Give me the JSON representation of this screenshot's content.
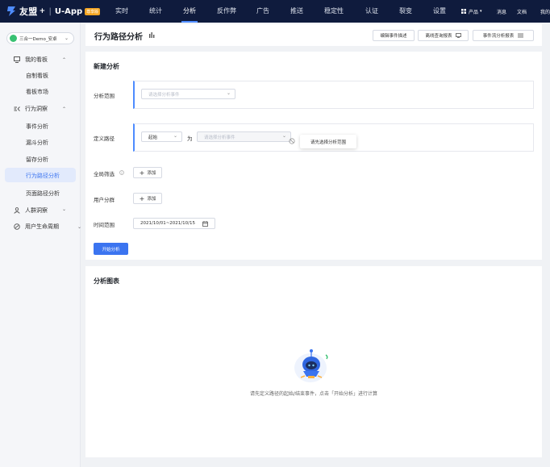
{
  "brand": {
    "name": "友盟",
    "plus": "+",
    "sep": "|",
    "app": "U-App",
    "badge": "尊享版"
  },
  "nav": {
    "items": [
      "实时",
      "统计",
      "分析",
      "反作弊",
      "广告",
      "推送",
      "稳定性",
      "认证",
      "裂变",
      "设置"
    ],
    "active": "分析"
  },
  "top_right": {
    "products": "产品",
    "messages": "消息",
    "docs": "文档",
    "mine": "我的"
  },
  "sidebar": {
    "app_selector": "三合一Demo_安卓",
    "groups": [
      {
        "label": "我的看板",
        "items": [
          "自制看板",
          "看板市场"
        ]
      },
      {
        "label": "行为洞察",
        "items": [
          "事件分析",
          "漏斗分析",
          "留存分析",
          "行为路径分析",
          "页面路径分析"
        ]
      },
      {
        "label": "人群洞察",
        "items": []
      },
      {
        "label": "用户生命周期",
        "items": []
      }
    ],
    "active_item": "行为路径分析"
  },
  "header": {
    "title": "行为路径分析",
    "buttons": [
      "编辑事件描述",
      "离线查询报表",
      "事件流分析报表"
    ]
  },
  "new_analysis": {
    "title": "新建分析",
    "scope": {
      "label": "分析范围",
      "placeholder": "请选择分析事件"
    },
    "path": {
      "label": "定义路径",
      "start_value": "起始",
      "connector": "为",
      "event_placeholder": "请选择分析事件",
      "tooltip": "请先选择分析范围"
    },
    "global_filter": {
      "label": "全局筛选",
      "add": "添加"
    },
    "user_segment": {
      "label": "用户分群",
      "add": "添加"
    },
    "time_range": {
      "label": "时间范围",
      "value": "2021/10/01~2021/10/15"
    },
    "start_button": "开始分析"
  },
  "chart_section": {
    "title": "分析图表",
    "empty_message": "请先定义路径的起始/结束事件，点击「开始分析」进行计算"
  },
  "colors": {
    "topbar": "#0f1b3d",
    "accent": "#3b74f0",
    "badge": "#f5a623",
    "page_bg": "#f0f2f5"
  }
}
